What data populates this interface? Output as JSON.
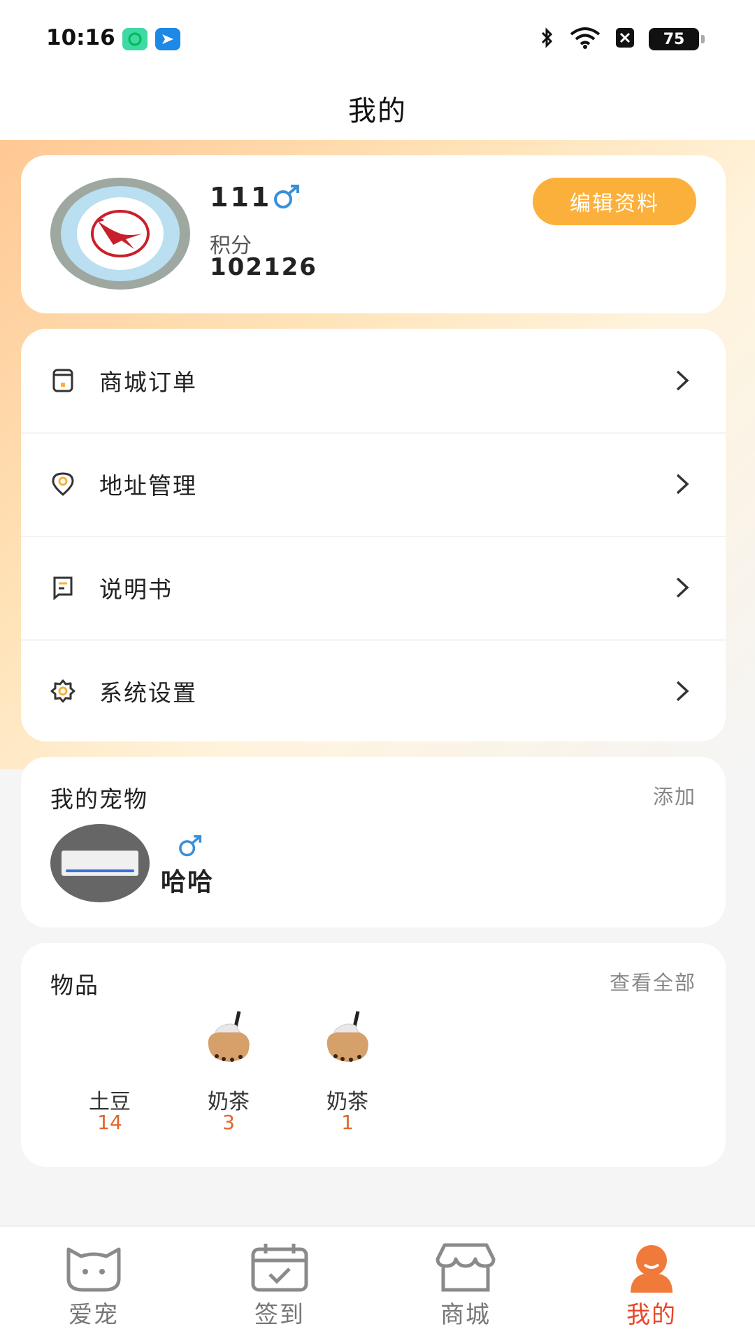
{
  "status_bar": {
    "time": "10:16",
    "battery": "75"
  },
  "nav": {
    "title": "我的"
  },
  "profile": {
    "username": "111",
    "gender_icon": "male-icon",
    "points_label": "积分",
    "points_value": "102126",
    "edit_label": "编辑资料"
  },
  "menu": {
    "items": [
      {
        "label": "商城订单",
        "icon": "order-icon"
      },
      {
        "label": "地址管理",
        "icon": "location-icon"
      },
      {
        "label": "说明书",
        "icon": "manual-icon"
      },
      {
        "label": "系统设置",
        "icon": "settings-icon"
      }
    ]
  },
  "pets": {
    "title": "我的宠物",
    "action": "添加",
    "list": [
      {
        "name": "哈哈",
        "gender_icon": "male-icon"
      }
    ]
  },
  "items": {
    "title": "物品",
    "action": "查看全部",
    "list": [
      {
        "name": "土豆",
        "count": "14"
      },
      {
        "name": "奶茶",
        "count": "3"
      },
      {
        "name": "奶茶",
        "count": "1"
      }
    ]
  },
  "tab_bar": {
    "tabs": [
      {
        "label": "爱宠",
        "icon": "pet-icon"
      },
      {
        "label": "签到",
        "icon": "calendar-icon"
      },
      {
        "label": "商城",
        "icon": "store-icon"
      },
      {
        "label": "我的",
        "icon": "profile-icon",
        "active": true
      }
    ]
  },
  "colors": {
    "accent": "#fbb03b",
    "active_tab": "#e8472a",
    "count": "#e0642a",
    "male": "#3a8fd8"
  }
}
